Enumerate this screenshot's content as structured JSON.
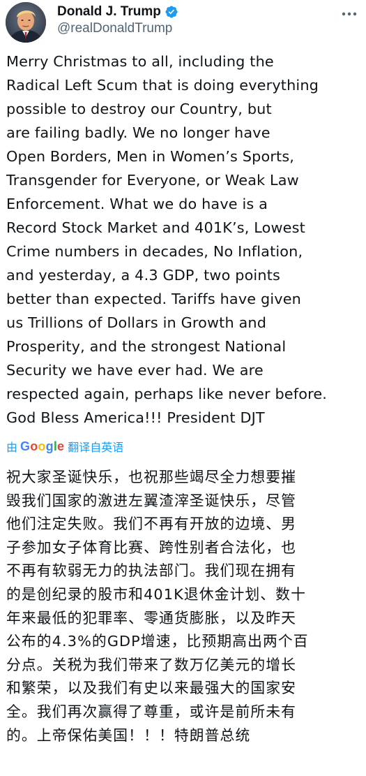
{
  "author": {
    "display_name": "Donald J. Trump",
    "handle": "@realDonaldTrump",
    "verified": true,
    "verified_color": "#1d9bf0",
    "avatar_icon": "profile-photo"
  },
  "tweet": {
    "text_lines": [
      "Merry Christmas to all, including the",
      "Radical Left Scum that is doing everything",
      "possible to destroy our Country, but",
      "are failing badly. We no longer have",
      "Open Borders, Men in Women’s Sports,",
      "Transgender for Everyone, or Weak Law",
      "Enforcement. What we do have is a",
      "Record Stock Market and 401K’s, Lowest",
      "Crime numbers in decades, No Inflation,",
      "and yesterday, a 4.3 GDP, two points",
      "better than expected. Tariffs have given",
      "us Trillions of Dollars in Growth and",
      "Prosperity, and the strongest National",
      "Security we have ever had. We are",
      "respected again, perhaps like never before.",
      "God Bless America!!! President DJT"
    ]
  },
  "translation": {
    "prefix": "由",
    "provider_letters": [
      "G",
      "o",
      "o",
      "g",
      "l",
      "e"
    ],
    "suffix": "翻译自英语",
    "link_color": "#1d9bf0",
    "text_lines": [
      "祝大家圣诞快乐，也祝那些竭尽全力想要摧",
      "毁我们国家的激进左翼渣滓圣诞快乐，尽管",
      "他们注定失败。我们不再有开放的边境、男",
      "子参加女子体育比赛、跨性别者合法化，也",
      "不再有软弱无力的执法部门。我们现在拥有",
      "的是创纪录的股市和401K退休金计划、数十",
      "年来最低的犯罪率、零通货膨胀，以及昨天",
      "公布的4.3%的GDP增速，比预期高出两个百",
      "分点。关税为我们带来了数万亿美元的增长",
      "和繁荣，以及我们有史以来最强大的国家安",
      "全。我们再次赢得了尊重，或许是前所未有",
      "的。上帝保佑美国！！！特朗普总统"
    ]
  },
  "more_icon": "ellipsis-icon"
}
